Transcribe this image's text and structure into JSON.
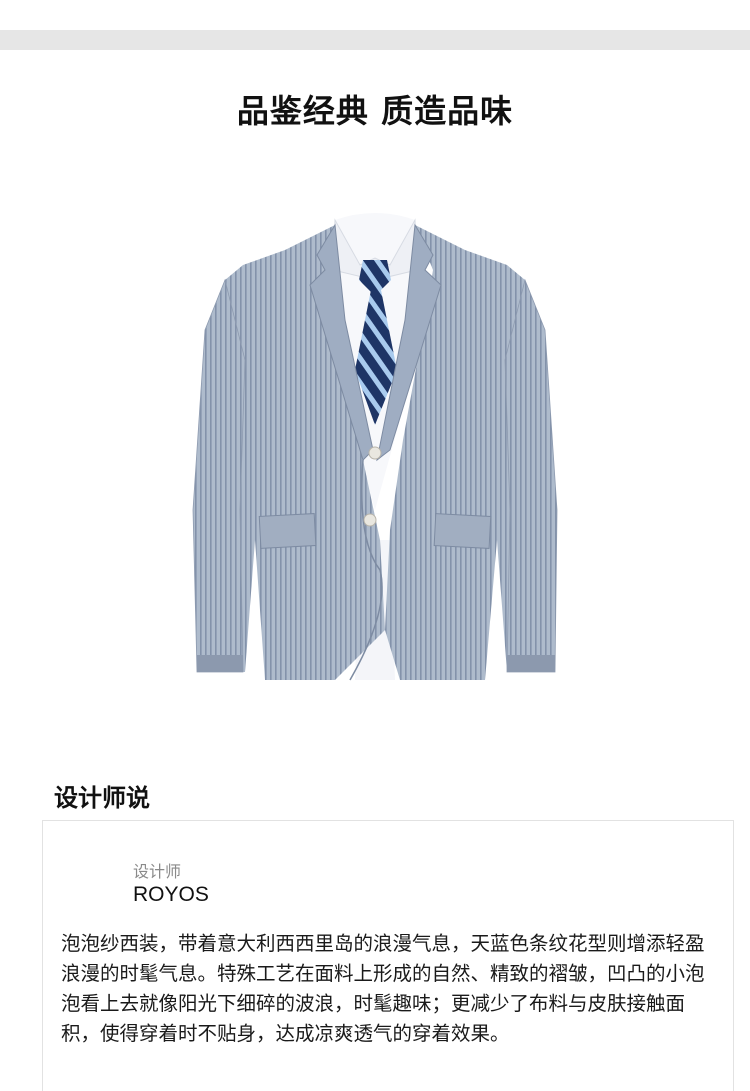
{
  "headline": "品鉴经典  质造品味",
  "product_image": {
    "icon": "seersucker-suit-jacket-image",
    "jacket_color": "#a9b6c8",
    "stripe_color": "#7f8ea6",
    "shirt_color": "#f7f8fb",
    "tie_navy": "#1e3566",
    "tie_light": "#a9cbee"
  },
  "designer_section": {
    "title": "设计师说",
    "role": "设计师",
    "name": "ROYOS",
    "description": "泡泡纱西装，带着意大利西西里岛的浪漫气息，天蓝色条纹花型则增添轻盈浪漫的时髦气息。特殊工艺在面料上形成的自然、精致的褶皱，凹凸的小泡泡看上去就像阳光下细碎的波浪，时髦趣味；更减少了布料与皮肤接触面积，使得穿着时不贴身，达成凉爽透气的穿着效果。"
  }
}
